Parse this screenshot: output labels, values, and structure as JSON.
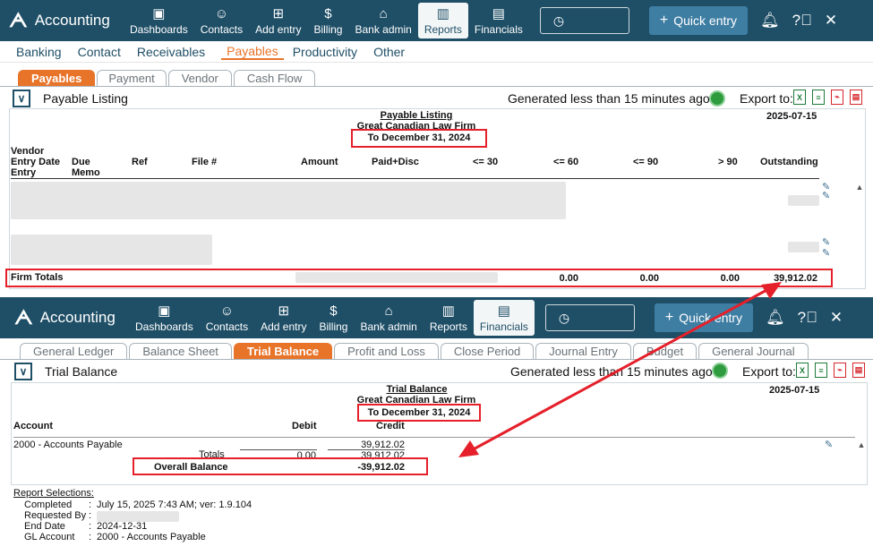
{
  "brand": "Accounting",
  "nav": {
    "items": [
      {
        "label": "Dashboards",
        "icon": "dashboard-icon"
      },
      {
        "label": "Contacts",
        "icon": "contacts-icon"
      },
      {
        "label": "Add entry",
        "icon": "add-entry-icon"
      },
      {
        "label": "Billing",
        "icon": "billing-icon"
      },
      {
        "label": "Bank admin",
        "icon": "bank-icon"
      },
      {
        "label": "Reports",
        "icon": "reports-icon"
      },
      {
        "label": "Financials",
        "icon": "financials-icon"
      }
    ],
    "quick_entry": "Quick entry"
  },
  "subnav": [
    "Banking",
    "Contact",
    "Receivables",
    "Payables",
    "Productivity",
    "Other"
  ],
  "tabs1": [
    "Payables",
    "Payment",
    "Vendor",
    "Cash Flow"
  ],
  "tabs2": [
    "General Ledger",
    "Balance Sheet",
    "Trial Balance",
    "Profit and Loss",
    "Close Period",
    "Journal Entry",
    "Budget",
    "General Journal"
  ],
  "report1": {
    "title": "Payable Listing",
    "generated": "Generated less than 15 minutes ago",
    "export": "Export to:",
    "report_title": "Payable Listing",
    "firm": "Great Canadian Law Firm",
    "period": "To December 31, 2024",
    "run_date": "2025-07-15",
    "columns": {
      "vendor": "Vendor",
      "entry_date": "Entry Date",
      "entry": "Entry",
      "due": "Due",
      "memo": "Memo",
      "ref": "Ref",
      "file": "File #",
      "amount": "Amount",
      "paid": "Paid+Disc",
      "b30": "<= 30",
      "b60": "<= 60",
      "b90": "<= 90",
      "g90": "> 90",
      "out": "Outstanding"
    },
    "totals": {
      "label": "Firm Totals",
      "b60": "0.00",
      "b90": "0.00",
      "g90": "0.00",
      "out": "39,912.02"
    }
  },
  "report2": {
    "title": "Trial Balance",
    "generated": "Generated less than 15 minutes ago",
    "export": "Export to:",
    "report_title": "Trial Balance",
    "firm": "Great Canadian Law Firm",
    "period": "To December 31, 2024",
    "run_date": "2025-07-15",
    "columns": {
      "account": "Account",
      "debit": "Debit",
      "credit": "Credit"
    },
    "row": {
      "account": "2000 - Accounts Payable",
      "credit": "39,912.02"
    },
    "totals": {
      "label": "Totals",
      "debit": "0.00",
      "credit": "39,912.02"
    },
    "overall": {
      "label": "Overall Balance",
      "value": "-39,912.02"
    },
    "selections": {
      "heading": "Report Selections:",
      "rows": [
        {
          "k": "Completed",
          "v": "July 15, 2025 7:43 AM; ver: 1.9.104"
        },
        {
          "k": "Requested By",
          "v": ""
        },
        {
          "k": "End Date",
          "v": "2024-12-31"
        },
        {
          "k": "GL Account",
          "v": "2000 - Accounts Payable"
        }
      ]
    }
  }
}
